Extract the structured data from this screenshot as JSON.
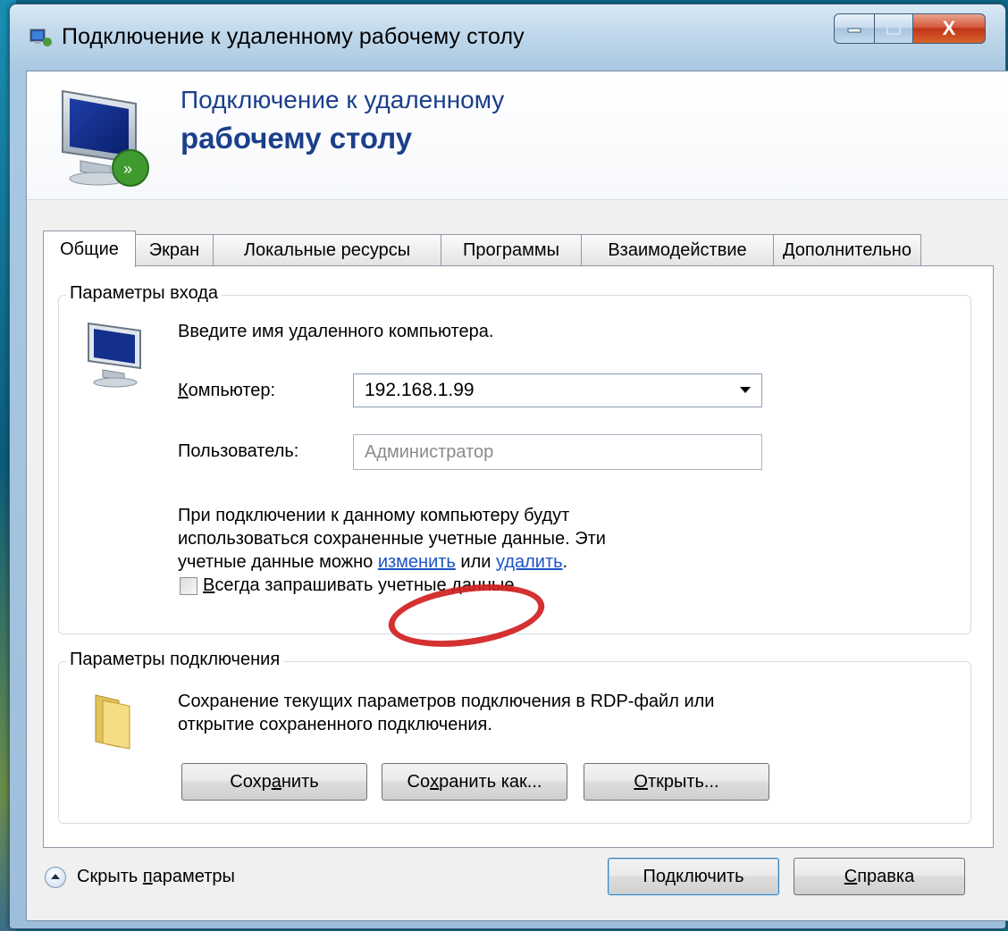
{
  "window": {
    "title": "Подключение к удаленному рабочему столу",
    "caption": {
      "close_glyph": "X"
    }
  },
  "banner": {
    "line1": "Подключение к удаленному",
    "line2": "рабочему столу"
  },
  "tabs": [
    {
      "label": "Общие",
      "active": true
    },
    {
      "label": "Экран",
      "active": false
    },
    {
      "label": "Локальные ресурсы",
      "active": false
    },
    {
      "label": "Программы",
      "active": false
    },
    {
      "label": "Взаимодействие",
      "active": false
    },
    {
      "label": "Дополнительно",
      "active": false
    }
  ],
  "login_group": {
    "legend": "Параметры входа",
    "instruction": "Введите имя удаленного компьютера.",
    "computer_label_accel": "К",
    "computer_label_rest": "омпьютер:",
    "computer_value": "192.168.1.99",
    "user_label": "Пользователь:",
    "user_value": "Администратор",
    "info_line1": "При подключении к данному компьютеру будут",
    "info_line2": "использоваться сохраненные учетные данные.  Эти",
    "info_line3_pre": "учетные данные можно ",
    "change_link": "изменить",
    "info_line3_mid": " или ",
    "delete_link": "удалить",
    "info_line3_post": ".",
    "always_ask_accel": "В",
    "always_ask_rest": "сегда запрашивать учетные данные",
    "always_ask_checked": false
  },
  "connection_group": {
    "legend": "Параметры подключения",
    "desc_line1": "Сохранение текущих параметров подключения в RDP-файл или",
    "desc_line2": "открытие сохраненного подключения.",
    "save_btn_pre": "Сохр",
    "save_btn_accel": "а",
    "save_btn_post": "нить",
    "saveas_btn_pre": "Со",
    "saveas_btn_accel": "х",
    "saveas_btn_post": "ранить как...",
    "open_btn_accel": "О",
    "open_btn_post": "ткрыть..."
  },
  "footer": {
    "hide_pre": "Скрыть ",
    "hide_accel": "п",
    "hide_post": "араметры",
    "connect_btn": "Подключить",
    "help_accel": "С",
    "help_post": "правка"
  },
  "colors": {
    "title_blue": "#1b3f8b",
    "link": "#1a53c7",
    "annotation_red": "#d11f1f"
  }
}
